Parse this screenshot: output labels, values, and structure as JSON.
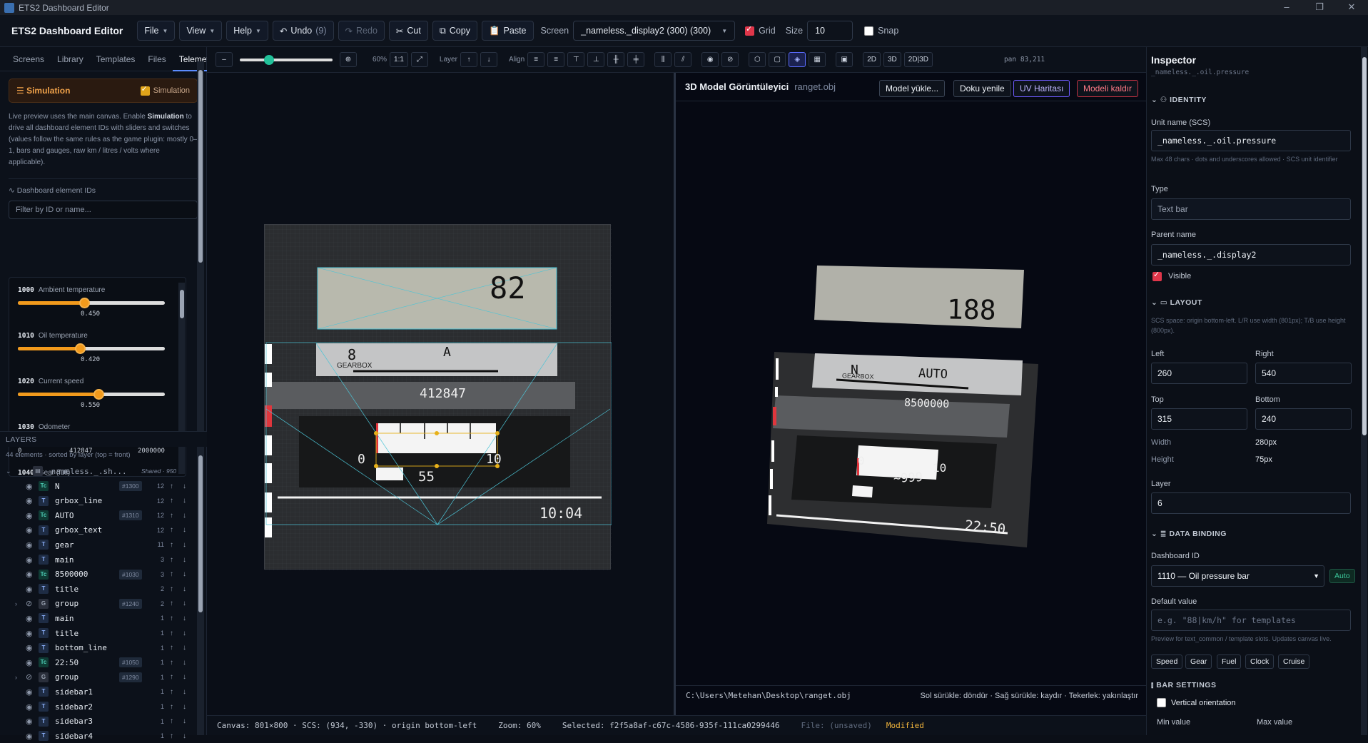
{
  "window": {
    "title": "ETS2 Dashboard Editor"
  },
  "toolbar": {
    "brand": "ETS2 Dashboard Editor",
    "file": "File",
    "view": "View",
    "help": "Help",
    "undo": "Undo",
    "undo_count": "(9)",
    "redo": "Redo",
    "cut": "Cut",
    "copy": "Copy",
    "paste": "Paste",
    "screen_label": "Screen",
    "screen_value": "_nameless._display2 (300) (300)",
    "grid_label": "Grid",
    "grid_checked": true,
    "size_label": "Size",
    "size_value": "10",
    "snap_label": "Snap",
    "snap_checked": false
  },
  "left": {
    "tabs": [
      "Screens",
      "Library",
      "Templates",
      "Files",
      "Telemetry"
    ],
    "active_tab": "Telemetry",
    "sim_title": "Simulation",
    "sim_toggle_label": "Simulation",
    "sim_desc_1": "Live preview uses the main canvas. Enable ",
    "sim_desc_bold": "Simulation",
    "sim_desc_2": " to drive all dashboard element IDs with sliders and switches (values follow the same rules as the game plugin: mostly 0–1, bars and gauges, raw km / litres / volts where applicable).",
    "ids_header": "Dashboard element IDs",
    "filter_placeholder": "Filter by ID or name...",
    "sliders": [
      {
        "id": "1000",
        "name": "Ambient temperature",
        "value": "0.450",
        "fraction": 0.45
      },
      {
        "id": "1010",
        "name": "Oil temperature",
        "value": "0.420",
        "fraction": 0.42
      },
      {
        "id": "1020",
        "name": "Current speed",
        "value": "0.550",
        "fraction": 0.55
      },
      {
        "id": "1030",
        "name": "Odometer",
        "value": "412847",
        "min": "0",
        "max": "2000000",
        "fraction": 0.206
      },
      {
        "id": "1040",
        "name": "Gear (full)"
      }
    ],
    "layers_title": "LAYERS",
    "layers_sub": "44 elements · sorted by layer (top = front)",
    "root_layer": {
      "name": "_nameless._.sh...",
      "tag": "Shared · 950"
    },
    "layers": [
      {
        "icon": "Tc",
        "name": "N",
        "badge": "#1300",
        "layer": "12"
      },
      {
        "icon": "T",
        "name": "grbox_line",
        "badge": "",
        "layer": "12"
      },
      {
        "icon": "Tc",
        "name": "AUTO",
        "badge": "#1310",
        "layer": "12"
      },
      {
        "icon": "T",
        "name": "grbox_text",
        "badge": "",
        "layer": "12"
      },
      {
        "icon": "T",
        "name": "gear",
        "badge": "",
        "layer": "11"
      },
      {
        "icon": "T",
        "name": "main",
        "badge": "",
        "layer": "3"
      },
      {
        "icon": "Tc",
        "name": "8500000",
        "badge": "#1030",
        "layer": "3"
      },
      {
        "icon": "T",
        "name": "title",
        "badge": "",
        "layer": "2"
      },
      {
        "icon": "G",
        "name": "group",
        "badge": "#1240",
        "layer": "2",
        "expand": true
      },
      {
        "icon": "T",
        "name": "main",
        "badge": "",
        "layer": "1"
      },
      {
        "icon": "T",
        "name": "title",
        "badge": "",
        "layer": "1"
      },
      {
        "icon": "T",
        "name": "bottom_line",
        "badge": "",
        "layer": "1"
      },
      {
        "icon": "Tc",
        "name": "22:50",
        "badge": "#1050",
        "layer": "1"
      },
      {
        "icon": "G",
        "name": "group",
        "badge": "#1290",
        "layer": "1",
        "expand": true
      },
      {
        "icon": "T",
        "name": "sidebar1",
        "badge": "",
        "layer": "1"
      },
      {
        "icon": "T",
        "name": "sidebar2",
        "badge": "",
        "layer": "1"
      },
      {
        "icon": "T",
        "name": "sidebar3",
        "badge": "",
        "layer": "1"
      },
      {
        "icon": "T",
        "name": "sidebar4",
        "badge": "",
        "layer": "1"
      }
    ]
  },
  "canvas_tools": {
    "zoom_pct": "60%",
    "one_to_one": "1:1",
    "layer_label": "Layer",
    "align_label": "Align",
    "btn_2d": "2D",
    "btn_3d": "3D",
    "btn_2d3d": "2D|3D",
    "pan": "pan 83,211"
  },
  "dash2d": {
    "value_top": "82",
    "gear": "8",
    "mode": "A",
    "gearbox_label": "GEARBOX",
    "odometer": "412847",
    "gauge_min": "0",
    "gauge_max": "10",
    "gauge_val": "55",
    "clock": "10:04"
  },
  "viewer": {
    "title": "3D Model Görüntüleyici",
    "file": "ranget.obj",
    "btn_load": "Model yükle...",
    "btn_texture": "Doku yenile",
    "btn_uv": "UV Haritası",
    "btn_remove": "Modeli kaldır",
    "path": "C:\\Users\\Metehan\\Desktop\\ranget.obj",
    "help": "Sol sürükle: döndür · Sağ sürükle: kaydır · Tekerlek: yakınlaştır"
  },
  "dash3d": {
    "value_top": "188",
    "gear": "N",
    "mode": "AUTO",
    "gearbox_label": "GEARBOX",
    "odometer": "8500000",
    "gauge_min": "0",
    "gauge_max": "10",
    "gauge_val": "~999",
    "clock": "22:50"
  },
  "status": {
    "canvas": "Canvas: 801×800 · SCS: (934, -330) · origin bottom-left",
    "zoom": "Zoom: 60%",
    "selected": "Selected: f2f5a8af-c67c-4586-935f-111ca0299446",
    "file": "File: (unsaved)",
    "modified": "Modified",
    "modified_color": "#f0b43c"
  },
  "inspector": {
    "title": "Inspector",
    "subtitle": "_nameless._.oil.pressure",
    "identity": "IDENTITY",
    "unit_label": "Unit name (SCS)",
    "unit_value": "_nameless._.oil.pressure",
    "unit_hint": "Max 48 chars · dots and underscores allowed · SCS unit identifier",
    "type_label": "Type",
    "type_value": "Text bar",
    "parent_label": "Parent name",
    "parent_value": "_nameless._.display2",
    "visible_label": "Visible",
    "layout": "LAYOUT",
    "layout_hint": "SCS space: origin bottom-left. L/R use width (801px); T/B use height (800px).",
    "left_label": "Left",
    "left_value": "260",
    "right_label": "Right",
    "right_value": "540",
    "top_label": "Top",
    "top_value": "315",
    "bottom_label": "Bottom",
    "bottom_value": "240",
    "width_label": "Width",
    "width_value": "280px",
    "height_label": "Height",
    "height_value": "75px",
    "layer_label": "Layer",
    "layer_value": "6",
    "binding": "DATA BINDING",
    "dash_id_label": "Dashboard ID",
    "dash_id_value": "1110 — Oil pressure bar",
    "auto": "Auto",
    "default_label": "Default value",
    "default_placeholder": "e.g. \"88|km/h\" for templates",
    "default_hint": "Preview for text_common / template slots. Updates canvas live.",
    "chips": [
      "Speed",
      "Gear",
      "Fuel",
      "Clock",
      "Cruise"
    ],
    "bar": "BAR SETTINGS",
    "vertical_label": "Vertical orientation",
    "min_label": "Min value",
    "max_label": "Max value"
  },
  "colors": {
    "accent": "#5b8cff",
    "sim_orange": "#f29a1c",
    "danger": "#e0364a",
    "uv": "#6f5cff"
  }
}
